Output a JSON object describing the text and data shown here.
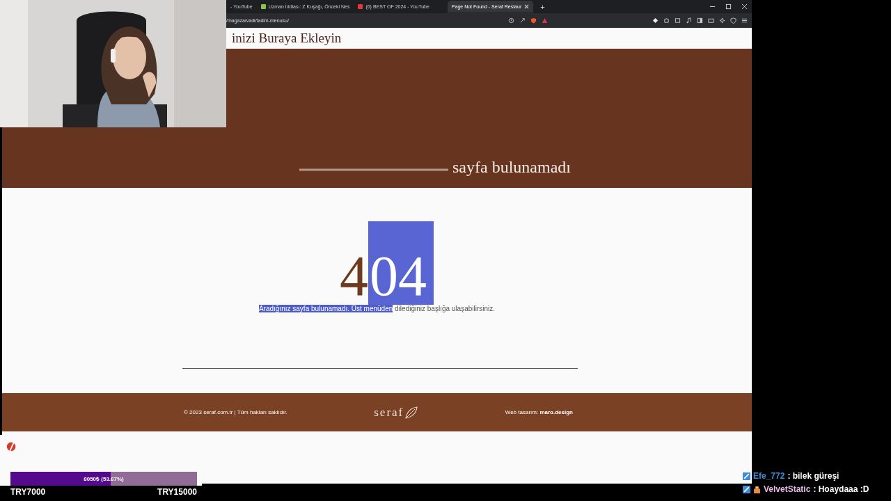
{
  "browser": {
    "tabs": [
      {
        "title": "- YouTube",
        "kind": "plain",
        "selected": false
      },
      {
        "title": "Uzman İddiası: Z Kuşağı, Önceki Nes",
        "kind": "news",
        "selected": false
      },
      {
        "title": "(6) BEST OF 2024 - YouTube",
        "kind": "video",
        "selected": false
      },
      {
        "title": "Page Not Found - Seraf Restaur",
        "kind": "plain",
        "selected": true
      }
    ],
    "new_tab": "+",
    "address": "/magaza/vadi/tadim-menusu/"
  },
  "site": {
    "header_title": "inizi Buraya Ekleyin",
    "hero_title": "sayfa bulunamadı",
    "error_code": {
      "plain": "4",
      "highlighted": "04"
    },
    "message": {
      "highlighted": "Aradığınız sayfa bulunamadı. Üst menüden",
      "rest": " dilediğiniz başlığa ulaşabilirsiniz."
    },
    "footer": {
      "copyright": "© 2023 seraf.com.tr | Tüm hakları saklıdır.",
      "logo": "seraf",
      "credit": "Web tasarım: **maro.design**"
    }
  },
  "donation_goal": {
    "reading": "8050₺ (53.67%)",
    "level": 0.5367,
    "min": "TRY7000",
    "max": "TRY15000"
  },
  "chat": [
    {
      "user": "Efe_772",
      "color": "#3d8bd9",
      "message": ": bilek güreşi",
      "kind": "member"
    },
    {
      "user": "VelvetStatic",
      "color": "#e7b8e8",
      "message": ": Hoaydaaa :D",
      "kind": "gifter"
    }
  ]
}
